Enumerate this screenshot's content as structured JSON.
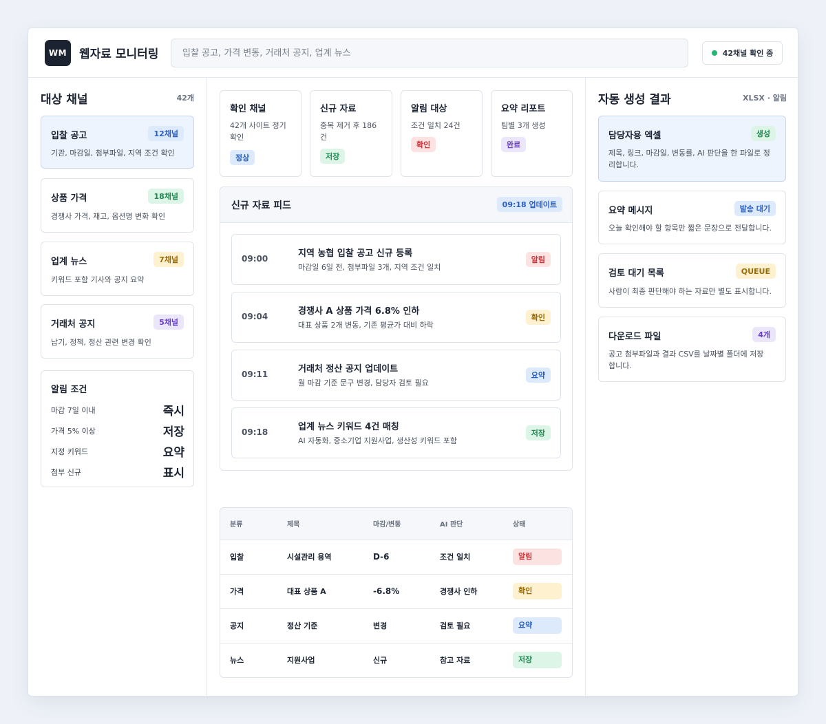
{
  "header": {
    "logo": "WM",
    "title": "웹자료 모니터링",
    "search_placeholder": "입찰 공고, 가격 변동, 거래처 공지, 업계 뉴스",
    "status": "42채널 확인 중",
    "status_color": "#22b573"
  },
  "left": {
    "title": "대상 채널",
    "count": "42개",
    "channels": [
      {
        "title": "입찰 공고",
        "badge": "12채널",
        "badge_color": "blue",
        "desc": "기관, 마감일, 첨부파일, 지역 조건 확인"
      },
      {
        "title": "상품 가격",
        "badge": "18채널",
        "badge_color": "green",
        "desc": "경쟁사 가격, 재고, 옵션명 변화 확인"
      },
      {
        "title": "업계 뉴스",
        "badge": "7채널",
        "badge_color": "yellow",
        "desc": "키워드 포함 기사와 공지 요약"
      },
      {
        "title": "거래처 공지",
        "badge": "5채널",
        "badge_color": "purple",
        "desc": "납기, 정책, 정산 관련 변경 확인"
      }
    ],
    "conditions": {
      "title": "알림 조건",
      "rows": [
        {
          "label": "마감 7일 이내",
          "value": "즉시"
        },
        {
          "label": "가격 5% 이상",
          "value": "저장"
        },
        {
          "label": "지정 키워드",
          "value": "요약"
        },
        {
          "label": "첨부 신규",
          "value": "표시"
        }
      ]
    }
  },
  "stats": [
    {
      "title": "확인 채널",
      "desc": "42개 사이트 정기 확인",
      "badge": "정상",
      "badge_color": "blue"
    },
    {
      "title": "신규 자료",
      "desc": "중복 제거 후 186건",
      "badge": "저장",
      "badge_color": "green"
    },
    {
      "title": "알림 대상",
      "desc": "조건 일치 24건",
      "badge": "확인",
      "badge_color": "red"
    },
    {
      "title": "요약 리포트",
      "desc": "팀별 3개 생성",
      "badge": "완료",
      "badge_color": "purple"
    }
  ],
  "feed": {
    "title": "신규 자료 피드",
    "updated": "09:18 업데이트",
    "items": [
      {
        "time": "09:00",
        "title": "지역 농협 입찰 공고 신규 등록",
        "desc": "마감일 6일 전, 첨부파일 3개, 지역 조건 일치",
        "badge": "알림",
        "badge_color": "red"
      },
      {
        "time": "09:04",
        "title": "경쟁사 A 상품 가격 6.8% 인하",
        "desc": "대표 상품 2개 변동, 기존 평균가 대비 하락",
        "badge": "확인",
        "badge_color": "yellow"
      },
      {
        "time": "09:11",
        "title": "거래처 정산 공지 업데이트",
        "desc": "월 마감 기준 문구 변경, 담당자 검토 필요",
        "badge": "요약",
        "badge_color": "blue"
      },
      {
        "time": "09:18",
        "title": "업계 뉴스 키워드 4건 매칭",
        "desc": "AI 자동화, 중소기업 지원사업, 생산성 키워드 포함",
        "badge": "저장",
        "badge_color": "green"
      }
    ]
  },
  "table": {
    "headers": [
      "분류",
      "제목",
      "마감/변동",
      "AI 판단",
      "상태"
    ],
    "rows": [
      {
        "category": "입찰",
        "title": "시설관리 용역",
        "change": "D-6",
        "ai": "조건 일치",
        "status": "알림",
        "status_color": "red"
      },
      {
        "category": "가격",
        "title": "대표 상품 A",
        "change": "-6.8%",
        "ai": "경쟁사 인하",
        "status": "확인",
        "status_color": "yellow"
      },
      {
        "category": "공지",
        "title": "정산 기준",
        "change": "변경",
        "ai": "검토 필요",
        "status": "요약",
        "status_color": "blue"
      },
      {
        "category": "뉴스",
        "title": "지원사업",
        "change": "신규",
        "ai": "참고 자료",
        "status": "저장",
        "status_color": "green"
      }
    ]
  },
  "right": {
    "title": "자동 생성 결과",
    "meta": "XLSX · 알림",
    "outputs": [
      {
        "title": "담당자용 엑셀",
        "badge": "생성",
        "badge_color": "green",
        "desc": "제목, 링크, 마감일, 변동률, AI 판단을 한 파일로 정리합니다."
      },
      {
        "title": "요약 메시지",
        "badge": "발송 대기",
        "badge_color": "blue",
        "desc": "오늘 확인해야 할 항목만 짧은 문장으로 전달합니다."
      },
      {
        "title": "검토 대기 목록",
        "badge": "QUEUE",
        "badge_color": "yellow",
        "desc": "사람이 최종 판단해야 하는 자료만 별도 표시합니다."
      },
      {
        "title": "다운로드 파일",
        "badge": "4개",
        "badge_color": "purple",
        "desc": "공고 첨부파일과 결과 CSV를 날짜별 폴더에 저장합니다."
      }
    ]
  }
}
